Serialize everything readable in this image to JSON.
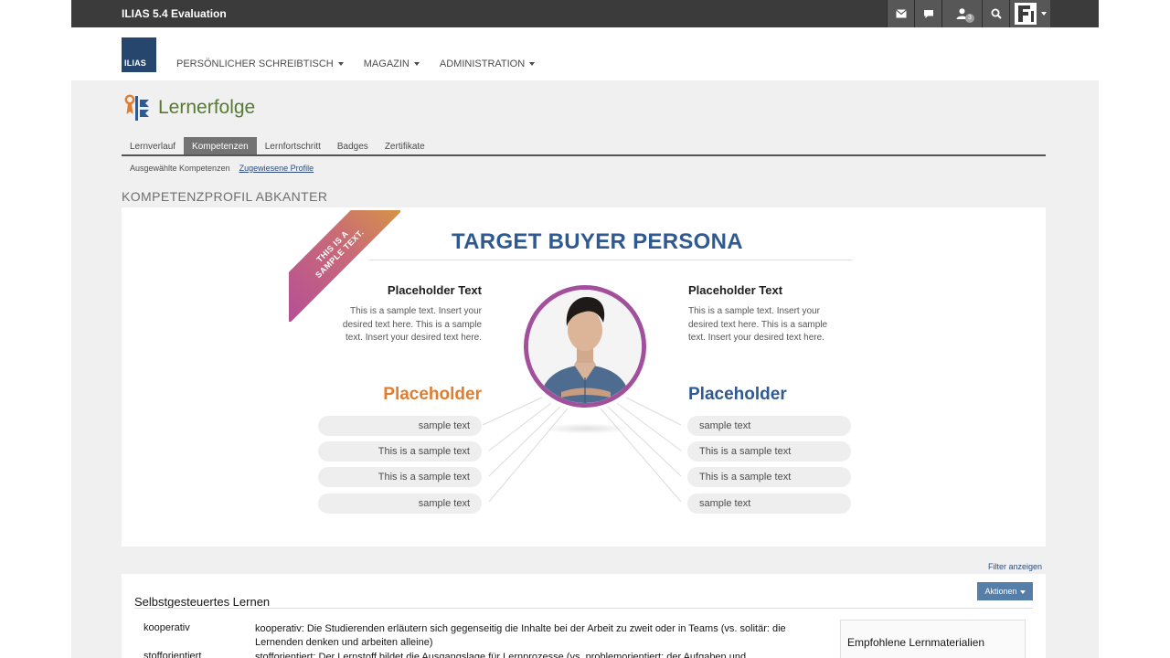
{
  "topbar": {
    "installation": "ILIAS 5.4 Evaluation",
    "user_badge_count": "3"
  },
  "header": {
    "logo_text": "ILIAS",
    "nav": [
      {
        "label": "PERSÖNLICHER SCHREIBTISCH"
      },
      {
        "label": "MAGAZIN"
      },
      {
        "label": "ADMINISTRATION"
      }
    ]
  },
  "page": {
    "title": "Lernerfolge",
    "tabs": [
      {
        "label": "Lernverlauf"
      },
      {
        "label": "Kompetenzen"
      },
      {
        "label": "Lernfortschritt"
      },
      {
        "label": "Badges"
      },
      {
        "label": "Zertifikate"
      }
    ],
    "subtabs": [
      {
        "label": "Ausgewählte Kompetenzen"
      },
      {
        "label": "Zugewiesene Profile"
      }
    ],
    "section_title": "KOMPETENZPROFIL ABKANTER"
  },
  "persona": {
    "ribbon_line1": "THIS IS A",
    "ribbon_line2": "SAMPLE TEXT.",
    "title": "TARGET BUYER PERSONA",
    "left_heading": "Placeholder Text",
    "left_body": "This is a sample text. Insert your desired text here. This is a sample text. Insert your desired text here.",
    "right_heading": "Placeholder Text",
    "right_body": "This is a sample text. Insert your desired text here. This is a sample text. Insert your desired text here.",
    "left_big": "Placeholder",
    "right_big": "Placeholder",
    "left_pills": [
      "sample text",
      "This is a sample text",
      "This is a sample text",
      "sample text"
    ],
    "right_pills": [
      "sample text",
      "This is a sample text",
      "This is a sample text",
      "sample text"
    ],
    "colors": {
      "orange": "#e07d2f",
      "blue": "#2f5a91",
      "purple": "#a24f9c"
    }
  },
  "bottom": {
    "filter_link": "Filter anzeigen",
    "panel_title": "Selbstgesteuertes Lernen",
    "actions_label": "Aktionen",
    "rows": [
      {
        "term": "kooperativ",
        "desc": "kooperativ: Die Studierenden erläutern sich gegenseitig die Inhalte bei der Arbeit zu zweit oder in Teams (vs. solitär: die Lernenden denken und arbeiten alleine)"
      },
      {
        "term": "stofforientiert",
        "desc": "stofforientiert: Der Lernstoff bildet die Ausgangslage für Lernprozesse (vs. problemorientiert: der Aufgaben und"
      }
    ],
    "side_box_title": "Empfohlene Lernmaterialien"
  },
  "icons": [
    "mail-icon",
    "chat-icon",
    "users-icon",
    "search-icon",
    "avatar"
  ]
}
